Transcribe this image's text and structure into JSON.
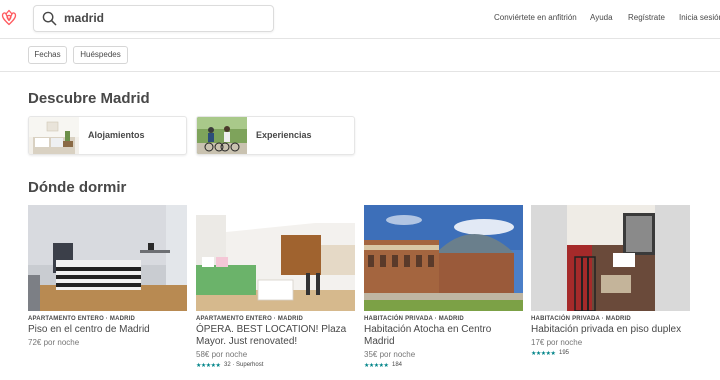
{
  "header": {
    "search_value": "madrid",
    "nav": [
      "Conviértete en anfitrión",
      "Ayuda",
      "Regístrate",
      "Inicia sesión"
    ]
  },
  "filters": [
    "Fechas",
    "Huéspedes"
  ],
  "discover": {
    "title": "Descubre Madrid",
    "cards": [
      "Alojamientos",
      "Experiencias"
    ]
  },
  "stay": {
    "title": "Dónde dormir",
    "listings": [
      {
        "kicker": "APARTAMENTO ENTERO · MADRID",
        "title": "Piso en el centro de Madrid",
        "price": "72€",
        "per": "por noche",
        "rating": "",
        "reviews": "",
        "superhost": ""
      },
      {
        "kicker": "APARTAMENTO ENTERO · MADRID",
        "title": "ÓPERA. BEST LOCATION! Plaza Mayor. Just renovated!",
        "price": "58€",
        "per": "por noche",
        "rating": "★★★★★",
        "reviews": "32",
        "superhost": "· Superhost"
      },
      {
        "kicker": "HABITACIÓN PRIVADA · MADRID",
        "title": "Habitación Atocha en Centro Madrid",
        "price": "35€",
        "per": "por noche",
        "rating": "★★★★★",
        "reviews": "184",
        "superhost": ""
      },
      {
        "kicker": "HABITACIÓN PRIVADA · MADRID",
        "title": "Habitación privada en piso duplex",
        "price": "17€",
        "per": "por noche",
        "rating": "★★★★★",
        "reviews": "195",
        "superhost": ""
      }
    ]
  },
  "colors": {
    "brand": "#ff5a5f",
    "text": "#484848",
    "muted": "#767676",
    "stars": "#008489"
  }
}
